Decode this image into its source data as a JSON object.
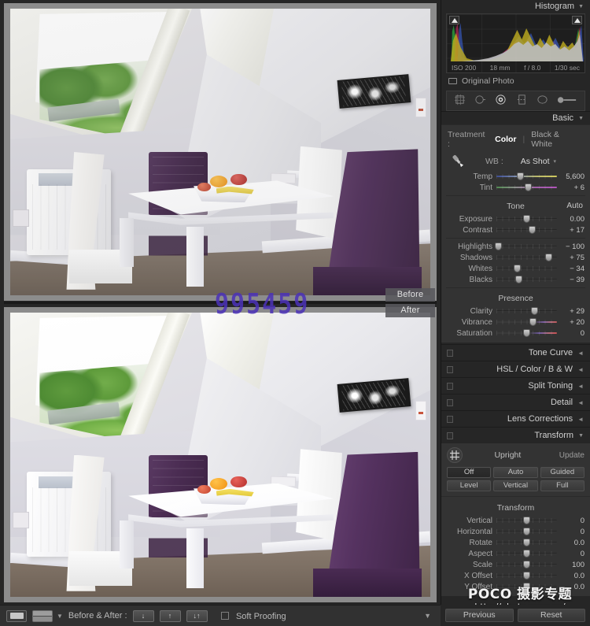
{
  "histogram": {
    "title": "Histogram",
    "iso": "ISO 200",
    "focal": "18 mm",
    "aperture": "f / 8.0",
    "shutter": "1/30 sec",
    "original_photo_label": "Original Photo",
    "clip_left_icon": "shadow-clipping-icon",
    "clip_right_icon": "highlight-clipping-icon"
  },
  "tool_strip": {
    "items": [
      {
        "name": "crop-overlay-tool",
        "glyph": "crop"
      },
      {
        "name": "spot-removal-tool",
        "glyph": "spot"
      },
      {
        "name": "red-eye-correction-tool",
        "glyph": "redeye"
      },
      {
        "name": "graduated-filter-tool",
        "glyph": "grad"
      },
      {
        "name": "radial-filter-tool",
        "glyph": "radial"
      },
      {
        "name": "adjustment-brush-tool",
        "glyph": "brush"
      }
    ]
  },
  "basic": {
    "title": "Basic",
    "treatment_label": "Treatment :",
    "treatment_color": "Color",
    "treatment_bw": "Black & White",
    "wb_label": "WB :",
    "wb_value": "As Shot",
    "white_balance": [
      {
        "name": "Temp",
        "value": "5,600",
        "pos": 40,
        "track": "temp"
      },
      {
        "name": "Tint",
        "value": "+ 6",
        "pos": 52,
        "track": "tint"
      }
    ],
    "tone_title": "Tone",
    "auto_label": "Auto",
    "tone": [
      {
        "name": "Exposure",
        "value": "0.00",
        "pos": 50,
        "track": ""
      },
      {
        "name": "Contrast",
        "value": "+ 17",
        "pos": 59,
        "track": ""
      },
      {
        "name": "Highlights",
        "value": "− 100",
        "pos": 3,
        "track": ""
      },
      {
        "name": "Shadows",
        "value": "+ 75",
        "pos": 86,
        "track": ""
      },
      {
        "name": "Whites",
        "value": "− 34",
        "pos": 35,
        "track": ""
      },
      {
        "name": "Blacks",
        "value": "− 39",
        "pos": 37,
        "track": ""
      }
    ],
    "presence_title": "Presence",
    "presence": [
      {
        "name": "Clarity",
        "value": "+ 29",
        "pos": 63,
        "track": ""
      },
      {
        "name": "Vibrance",
        "value": "+ 20",
        "pos": 60,
        "track": "vib"
      },
      {
        "name": "Saturation",
        "value": "0",
        "pos": 50,
        "track": "sat"
      }
    ]
  },
  "panels": [
    {
      "label": "Tone Curve",
      "name": "tone-curve"
    },
    {
      "label": "HSL / Color / B & W",
      "name": "hsl-color-bw"
    },
    {
      "label": "Split Toning",
      "name": "split-toning"
    },
    {
      "label": "Detail",
      "name": "detail"
    },
    {
      "label": "Lens Corrections",
      "name": "lens-corrections"
    }
  ],
  "transform": {
    "title": "Transform",
    "upright_label": "Upright",
    "update_label": "Update",
    "buttons": [
      {
        "label": "Off",
        "selected": true
      },
      {
        "label": "Auto",
        "selected": false
      },
      {
        "label": "Guided",
        "selected": false
      },
      {
        "label": "Level",
        "selected": false
      },
      {
        "label": "Vertical",
        "selected": false
      },
      {
        "label": "Full",
        "selected": false
      }
    ],
    "group_title": "Transform",
    "sliders": [
      {
        "name": "Vertical",
        "value": "0",
        "pos": 50
      },
      {
        "name": "Horizontal",
        "value": "0",
        "pos": 50
      },
      {
        "name": "Rotate",
        "value": "0.0",
        "pos": 50
      },
      {
        "name": "Aspect",
        "value": "0",
        "pos": 50
      },
      {
        "name": "Scale",
        "value": "100",
        "pos": 50
      },
      {
        "name": "X Offset",
        "value": "0.0",
        "pos": 50
      },
      {
        "name": "Y Offset",
        "value": "0.0",
        "pos": 50
      }
    ]
  },
  "footer_buttons": {
    "previous": "Previous",
    "reset": "Reset"
  },
  "toolbar": {
    "loupe_view_icon": "loupe-view-icon",
    "compare_view_icon": "before-after-view-icon",
    "caret_icon": "chevron-down-icon",
    "before_after_label": "Before & After :",
    "mode_buttons": [
      {
        "name": "copy-after-settings-to-before",
        "glyph": "↓"
      },
      {
        "name": "copy-before-settings-to-after",
        "glyph": "↑"
      },
      {
        "name": "swap-before-and-after-settings",
        "glyph": "↓↑"
      }
    ],
    "soft_proofing_label": "Soft Proofing",
    "soft_proofing_checked": false,
    "right_caret_icon": "chevron-down-icon"
  },
  "preview": {
    "before_label": "Before",
    "after_label": "After",
    "overlay_digits": "995459"
  },
  "watermark": {
    "line1": "POCO 摄影专题",
    "line2": "http://photo.poco.cn/"
  },
  "colors": {
    "panel_bg": "#262626",
    "section_bg": "#333333",
    "accent_text": "#ffffff",
    "watermark_purple": "#4b32b8"
  }
}
